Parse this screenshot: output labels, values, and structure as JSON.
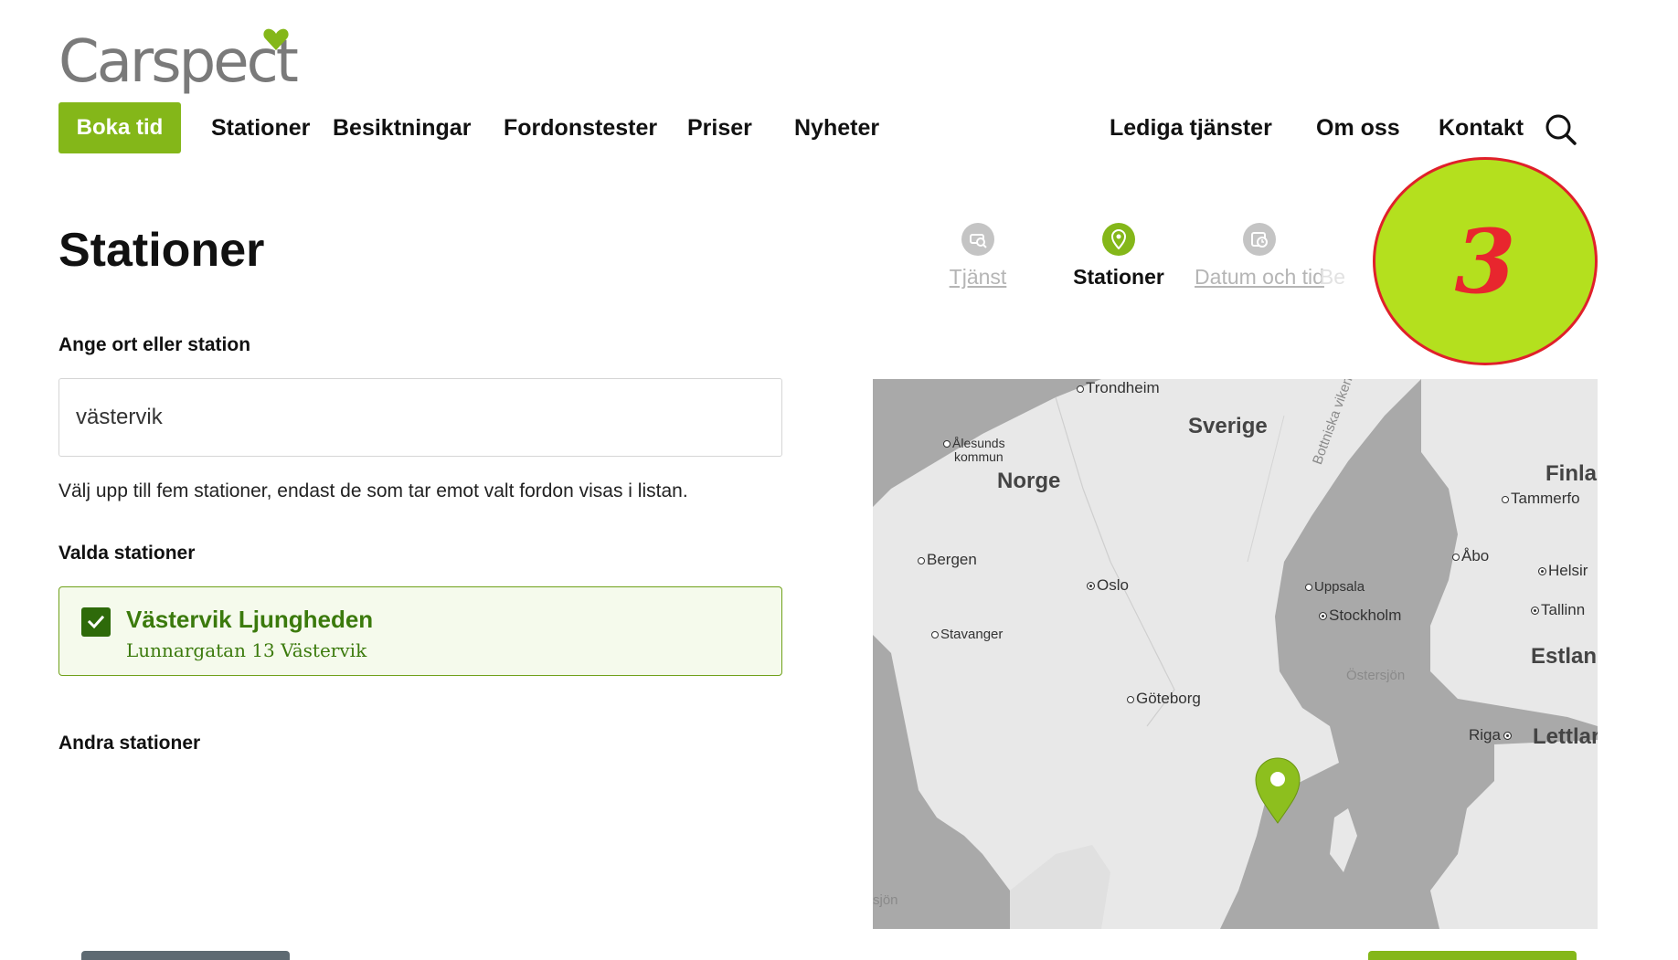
{
  "brand": {
    "name": "Carspect",
    "accent": "#84b719",
    "heart_color": "#84b719"
  },
  "nav": {
    "book_label": "Boka tid",
    "links": [
      "Stationer",
      "Besiktningar",
      "Fordonstester",
      "Priser",
      "Nyheter",
      "Lediga tjänster",
      "Om oss",
      "Kontakt"
    ],
    "search_icon": "search-icon"
  },
  "page": {
    "title": "Stationer"
  },
  "steps": [
    {
      "label": "Tjänst",
      "state": "done",
      "icon": "car-search-icon"
    },
    {
      "label": "Stationer",
      "state": "active",
      "icon": "map-pin-icon"
    },
    {
      "label": "Datum och tid",
      "state": "done",
      "icon": "calendar-clock-icon"
    },
    {
      "label": "Be",
      "state": "future"
    }
  ],
  "badge": {
    "number": "3",
    "fill": "#b4e01e",
    "stroke": "#e0202a"
  },
  "form": {
    "search_label": "Ange ort eller station",
    "search_value": "västervik",
    "help_text": "Välj upp till fem stationer, endast de som tar emot valt fordon visas i listan.",
    "selected_heading": "Valda stationer",
    "selected_stations": [
      {
        "name": "Västervik Ljungheden",
        "address": "Lunnargatan 13 Västervik",
        "checked": true
      }
    ],
    "other_heading": "Andra stationer"
  },
  "map": {
    "countries": [
      "Sverige",
      "Norge",
      "Finla",
      "Estlan",
      "Lettlar"
    ],
    "seas": [
      "Bottniska viken",
      "Östersjön",
      "sjön"
    ],
    "cities": [
      "Trondheim",
      "Ålesunds",
      "kommun",
      "Bergen",
      "Oslo",
      "Stavanger",
      "Göteborg",
      "Uppsala",
      "Stockholm",
      "Åbo",
      "Helsir",
      "Tallinn",
      "Tammerfo",
      "Riga"
    ],
    "marker": "Västervik Ljungheden"
  }
}
